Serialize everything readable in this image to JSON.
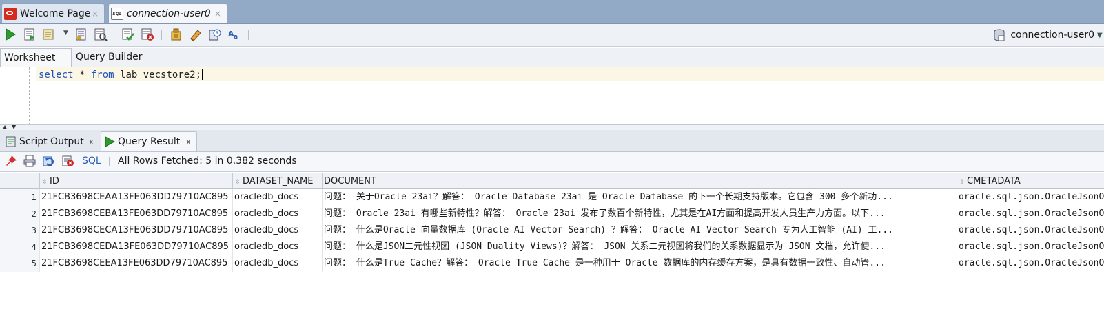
{
  "document_tabs": [
    {
      "label": "Welcome Page",
      "icon": "oracle-icon",
      "close": "×"
    },
    {
      "label": "connection-user0",
      "icon": "sql-worksheet-icon",
      "close": "×"
    }
  ],
  "toolbar": {
    "connection": "connection-user0",
    "buttons": [
      "run-statement-icon",
      "run-script-icon",
      "explain-plan-icon",
      "autotrace-icon",
      "sql-tuning-icon",
      "commit-icon",
      "rollback-icon",
      "unshared-sql-icon",
      "clear-icon",
      "sql-history-icon",
      "format-icon"
    ]
  },
  "worksheet_tabs": {
    "worksheet": "Worksheet",
    "query_builder": "Query Builder"
  },
  "editor": {
    "keyword1": "select",
    "rest1": " * ",
    "keyword2": "from",
    "rest2": " lab_vecstore2;"
  },
  "result_tabs": {
    "script_output": "Script Output",
    "query_result": "Query Result",
    "close": "x"
  },
  "result_toolbar": {
    "sql_label": "SQL",
    "status": "All Rows Fetched: 5 in 0.382 seconds"
  },
  "grid": {
    "columns": [
      "ID",
      "DATASET_NAME",
      "DOCUMENT",
      "CMETADATA"
    ],
    "rows": [
      {
        "num": "1",
        "id": "21FCB3698CEAA13FE063DD79710AC895",
        "dataset": "oracledb_docs",
        "document": "问题： 关于Oracle 23ai？解答： Oracle Database 23ai 是 Oracle Database 的下一个长期支持版本。它包含 300 多个新功...",
        "cmetadata": "oracle.sql.json.OracleJsonObjectImpl"
      },
      {
        "num": "2",
        "id": "21FCB3698CEBA13FE063DD79710AC895",
        "dataset": "oracledb_docs",
        "document": "问题： Oracle 23ai 有哪些新特性？解答： Oracle 23ai 发布了数百个新特性，尤其是在AI方面和提高开发人员生产力方面。以下...",
        "cmetadata": "oracle.sql.json.OracleJsonObjectImpl"
      },
      {
        "num": "3",
        "id": "21FCB3698CECA13FE063DD79710AC895",
        "dataset": "oracledb_docs",
        "document": "问题： 什么是Oracle 向量数据库 (Oracle AI Vector Search) ？解答： Oracle AI Vector Search 专为人工智能 (AI) 工...",
        "cmetadata": "oracle.sql.json.OracleJsonObjectImpl"
      },
      {
        "num": "4",
        "id": "21FCB3698CEDA13FE063DD79710AC895",
        "dataset": "oracledb_docs",
        "document": "问题： 什么是JSON二元性视图 (JSON Duality Views)？解答： JSON 关系二元视图将我们的关系数据显示为 JSON 文档，允许使...",
        "cmetadata": "oracle.sql.json.OracleJsonObjectImpl"
      },
      {
        "num": "5",
        "id": "21FCB3698CEEA13FE063DD79710AC895",
        "dataset": "oracledb_docs",
        "document": "问题： 什么是True Cache？解答： Oracle True Cache 是一种用于 Oracle 数据库的内存缓存方案，是具有数据一致性、自动管...",
        "cmetadata": "oracle.sql.json.OracleJsonObjectImpl"
      }
    ]
  },
  "colors": {
    "tabstrip": "#93aac7",
    "keyword": "#2255c0",
    "run_green": "#2e9b2e",
    "sql_link": "#2a60b5"
  }
}
